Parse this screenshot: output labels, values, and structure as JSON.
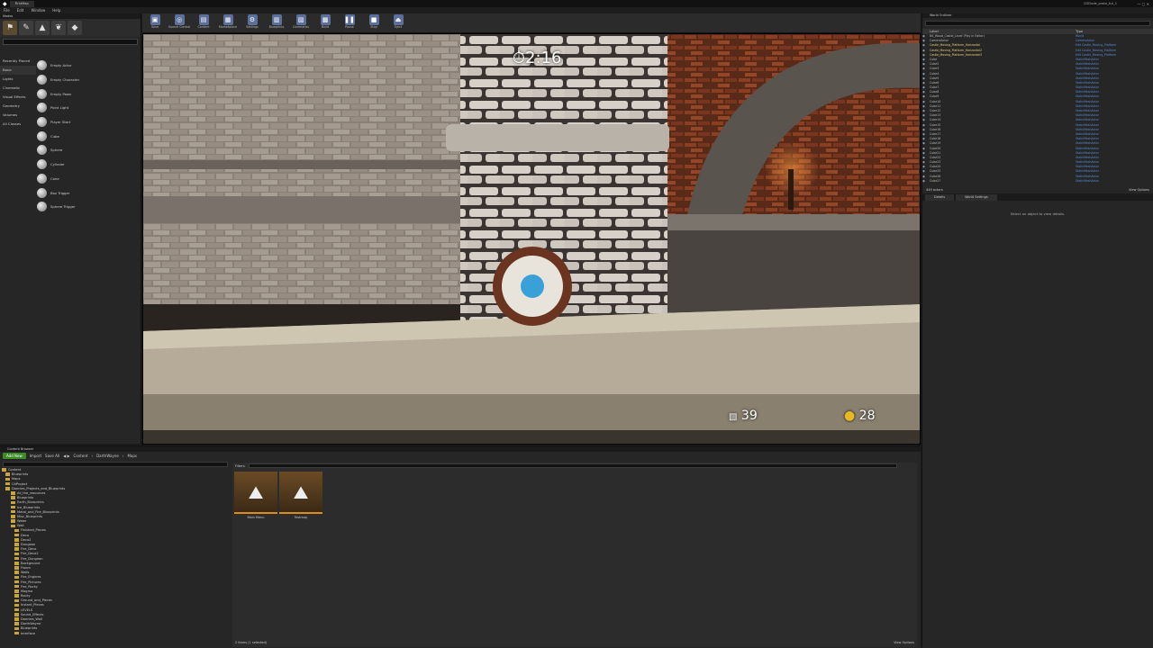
{
  "window": {
    "title": "CDDude_proto_tut_1",
    "project": "FirstMap"
  },
  "menu": [
    "File",
    "Edit",
    "Window",
    "Help"
  ],
  "modes": {
    "tab": "Modes",
    "categories": [
      "Recently Placed",
      "Basic",
      "Lights",
      "Cinematic",
      "Visual Effects",
      "Geometry",
      "Volumes",
      "All Classes"
    ],
    "items": [
      "Empty Actor",
      "Empty Character",
      "Empty Pawn",
      "Point Light",
      "Player Start",
      "Cube",
      "Sphere",
      "Cylinder",
      "Cone",
      "Box Trigger",
      "Sphere Trigger"
    ]
  },
  "toolbar": [
    "Save",
    "Source Control",
    "Content",
    "Marketplace",
    "Settings",
    "Blueprints",
    "Cinematics",
    "Build",
    "Pause",
    "Stop",
    "Eject"
  ],
  "hud": {
    "timer": "2:16",
    "rocks": "39",
    "coins": "28"
  },
  "outliner": {
    "tab": "World Outliner",
    "col_label": "Label",
    "col_type": "Type",
    "rows": [
      {
        "label": "NS_Wood_Castle_Level (Play in Editor)",
        "type": "World"
      },
      {
        "label": "CameraActor",
        "type": "CameraActor"
      },
      {
        "label": "Castle_Moving_Platform_Horizontal",
        "type": "Edit Castle_Moving_Platform"
      },
      {
        "label": "Castle_Moving_Platform_Horizontal2",
        "type": "Edit Castle_Moving_Platform"
      },
      {
        "label": "Castle_Moving_Platform_Horizontal3",
        "type": "Edit Castle_Moving_Platform"
      },
      {
        "label": "Cube",
        "type": "StaticMeshActor"
      },
      {
        "label": "Cube2",
        "type": "StaticMeshActor"
      },
      {
        "label": "Cube3",
        "type": "StaticMeshActor"
      },
      {
        "label": "Cube4",
        "type": "StaticMeshActor"
      },
      {
        "label": "Cube5",
        "type": "StaticMeshActor"
      },
      {
        "label": "Cube6",
        "type": "StaticMeshActor"
      },
      {
        "label": "Cube7",
        "type": "StaticMeshActor"
      },
      {
        "label": "Cube8",
        "type": "StaticMeshActor"
      },
      {
        "label": "Cube9",
        "type": "StaticMeshActor"
      },
      {
        "label": "Cube10",
        "type": "StaticMeshActor"
      },
      {
        "label": "Cube11",
        "type": "StaticMeshActor"
      },
      {
        "label": "Cube12",
        "type": "StaticMeshActor"
      },
      {
        "label": "Cube13",
        "type": "StaticMeshActor"
      },
      {
        "label": "Cube14",
        "type": "StaticMeshActor"
      },
      {
        "label": "Cube15",
        "type": "StaticMeshActor"
      },
      {
        "label": "Cube16",
        "type": "StaticMeshActor"
      },
      {
        "label": "Cube17",
        "type": "StaticMeshActor"
      },
      {
        "label": "Cube18",
        "type": "StaticMeshActor"
      },
      {
        "label": "Cube19",
        "type": "StaticMeshActor"
      },
      {
        "label": "Cube20",
        "type": "StaticMeshActor"
      },
      {
        "label": "Cube21",
        "type": "StaticMeshActor"
      },
      {
        "label": "Cube22",
        "type": "StaticMeshActor"
      },
      {
        "label": "Cube23",
        "type": "StaticMeshActor"
      },
      {
        "label": "Cube24",
        "type": "StaticMeshActor"
      },
      {
        "label": "Cube25",
        "type": "StaticMeshActor"
      },
      {
        "label": "Cube26",
        "type": "StaticMeshActor"
      },
      {
        "label": "Cube27",
        "type": "StaticMeshActor"
      }
    ],
    "footer": "449 actors",
    "view_options": "View Options"
  },
  "details": {
    "tabs": [
      "Details",
      "World Settings"
    ],
    "empty": "Select an object to view details."
  },
  "content_browser": {
    "tab": "Content Browser",
    "add_new": "Add New",
    "import": "Import",
    "save_all": "Save All",
    "path": [
      "Content",
      "DarthWayne",
      "Maps"
    ],
    "filters": "Filters",
    "search_placeholder": "Search Maps",
    "tree": [
      "Content",
      "Blueprints",
      "Maps",
      "CitProject",
      "Dannies_Projects_and_Blueprints",
      "All_the_resources",
      "Blueprints",
      "Earth_Blueprints",
      "Ice_Blueprints",
      "Metal_and_Fire_Blueprints",
      "Misc_Blueprints",
      "Water",
      "Wall",
      "Finished_Pieces",
      "Deco",
      "Deco2",
      "Dungeon",
      "Fire_Deco",
      "Fire_Deco2",
      "Fire_Dungeon",
      "Background",
      "Floors",
      "Walls",
      "Fire_Engines",
      "Fire_Pictures",
      "Fire_Rocky",
      "Magma",
      "Rocky",
      "Ground_and_Pieces",
      "Instant_Pieces",
      "LEVELS",
      "Sound_Effects",
      "Dannies_Wall",
      "DarthWayne",
      "Blueprints",
      "Interface"
    ],
    "assets": [
      "Main Menu",
      "Testmap"
    ],
    "status": "2 items (1 selected)",
    "view_options": "View Options"
  }
}
